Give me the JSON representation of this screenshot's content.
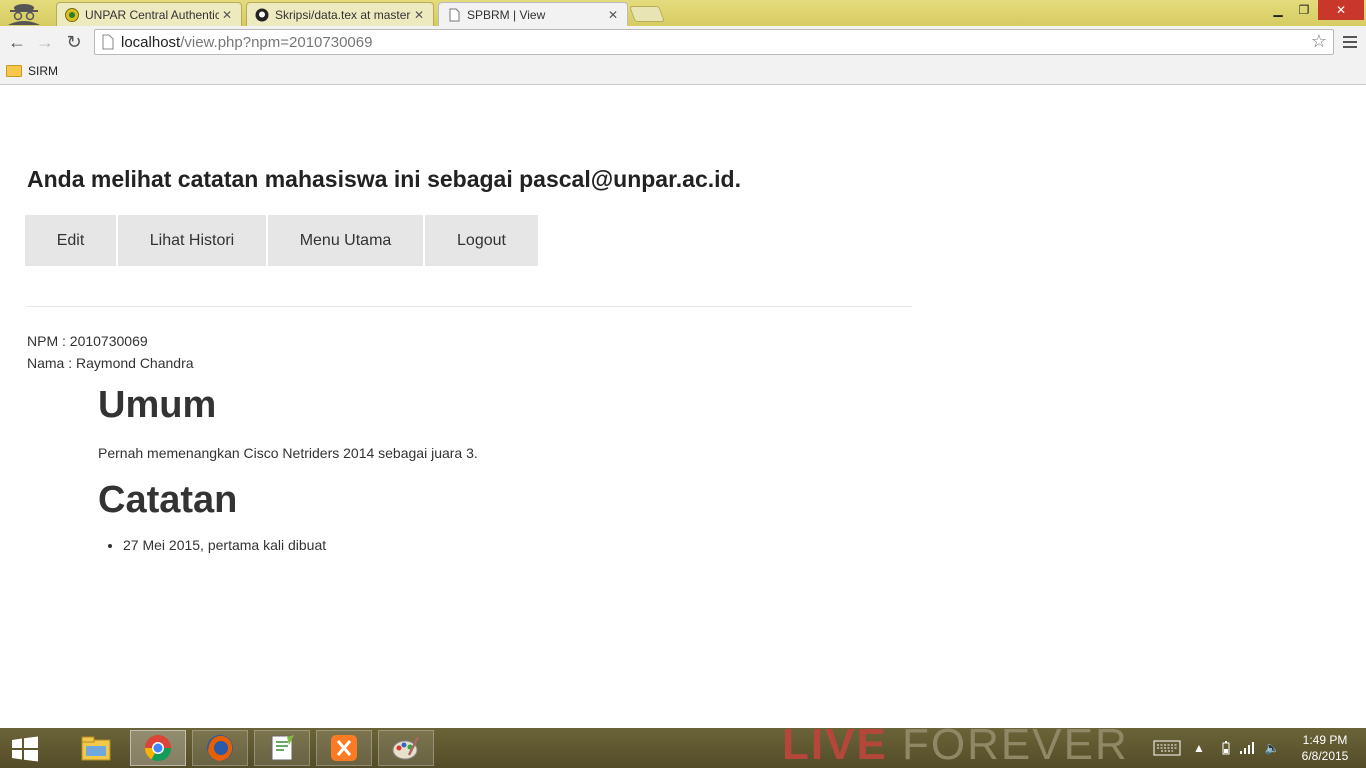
{
  "browser": {
    "tabs": [
      {
        "title": "UNPAR Central Authenticatio",
        "icon": "unpar-favicon"
      },
      {
        "title": "Skripsi/data.tex at master",
        "icon": "github-favicon"
      },
      {
        "title": "SPBRM | View",
        "icon": "page-favicon"
      }
    ],
    "url_host": "localhost",
    "url_rest": "/view.php?npm=2010730069",
    "bookmarks": [
      {
        "label": "SIRM",
        "icon": "folder-icon"
      }
    ]
  },
  "page": {
    "heading": "Anda melihat catatan mahasiswa ini sebagai pascal@unpar.ac.id.",
    "buttons": {
      "edit": "Edit",
      "history": "Lihat Histori",
      "main_menu": "Menu Utama",
      "logout": "Logout"
    },
    "npm_line": "NPM : 2010730069",
    "name_line": "Nama : Raymond Chandra",
    "umum_heading": "Umum",
    "umum_text": "Pernah memenangkan Cisco Netriders 2014 sebagai juara 3.",
    "catatan_heading": "Catatan",
    "catatan_items": [
      "27 Mei 2015, pertama kali dibuat"
    ]
  },
  "taskbar": {
    "apps": [
      "file-explorer-icon",
      "chrome-icon",
      "firefox-icon",
      "notepad-plus-plus-icon",
      "xampp-icon",
      "paint-icon"
    ],
    "wallpaper_text_1": "LIVE",
    "wallpaper_text_2": "FOREVER",
    "time": "1:49 PM",
    "date": "6/8/2015"
  },
  "colors": {
    "tabstrip": "#d9d06a",
    "button_bg": "#e6e6e6",
    "taskbar": "#5e5630",
    "close_red": "#c8372a"
  }
}
